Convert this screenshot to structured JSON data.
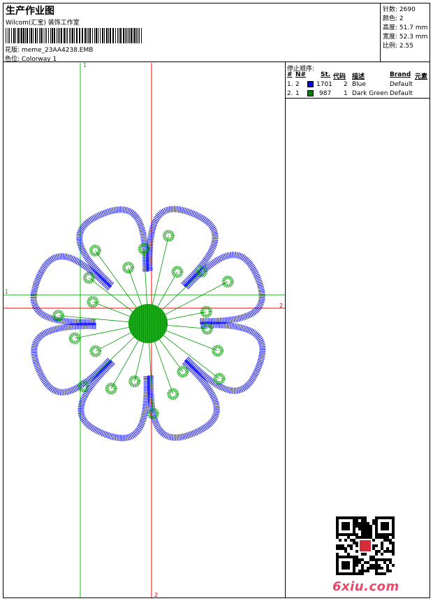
{
  "header": {
    "title": "生产作业图",
    "company": "Wilcom(汇宝) 装饰工作室",
    "pattern_label": "花版:",
    "pattern_value": "meme_23AA4238.EMB",
    "colorway_label": "色位:",
    "colorway_value": "Colorway 1"
  },
  "stats": {
    "stitches_label": "针数:",
    "stitches_value": "2690",
    "colors_label": "颜色:",
    "colors_value": "2",
    "height_label": "高度:",
    "height_value": "51.7 mm",
    "width_label": "宽度:",
    "width_value": "52.3 mm",
    "scale_label": "比例:",
    "scale_value": "2.55"
  },
  "stops": {
    "title": "停止顺序:",
    "headers": {
      "num": "#",
      "needle": "N#",
      "st": "St.",
      "code": "代码",
      "desc": "描述",
      "brand": "Brand",
      "element": "元素"
    },
    "rows": [
      {
        "num": "1.",
        "needle": "2",
        "color": "#0000ff",
        "st": "1701",
        "code": "2",
        "desc": "Blue",
        "brand": "Default"
      },
      {
        "num": "2.",
        "needle": "1",
        "color": "#008000",
        "st": "987",
        "code": "1",
        "desc": "Dark Green",
        "brand": "Default"
      }
    ]
  },
  "guides": {
    "v_green_label": "1",
    "h_green_label": "1",
    "v_red_label": "2",
    "h_red_label": "2"
  },
  "colors": {
    "blue": "#0000ff",
    "green": "#009900",
    "red": "#ff0000",
    "guide_green": "#00cc00"
  },
  "watermark": "6xiu.com"
}
